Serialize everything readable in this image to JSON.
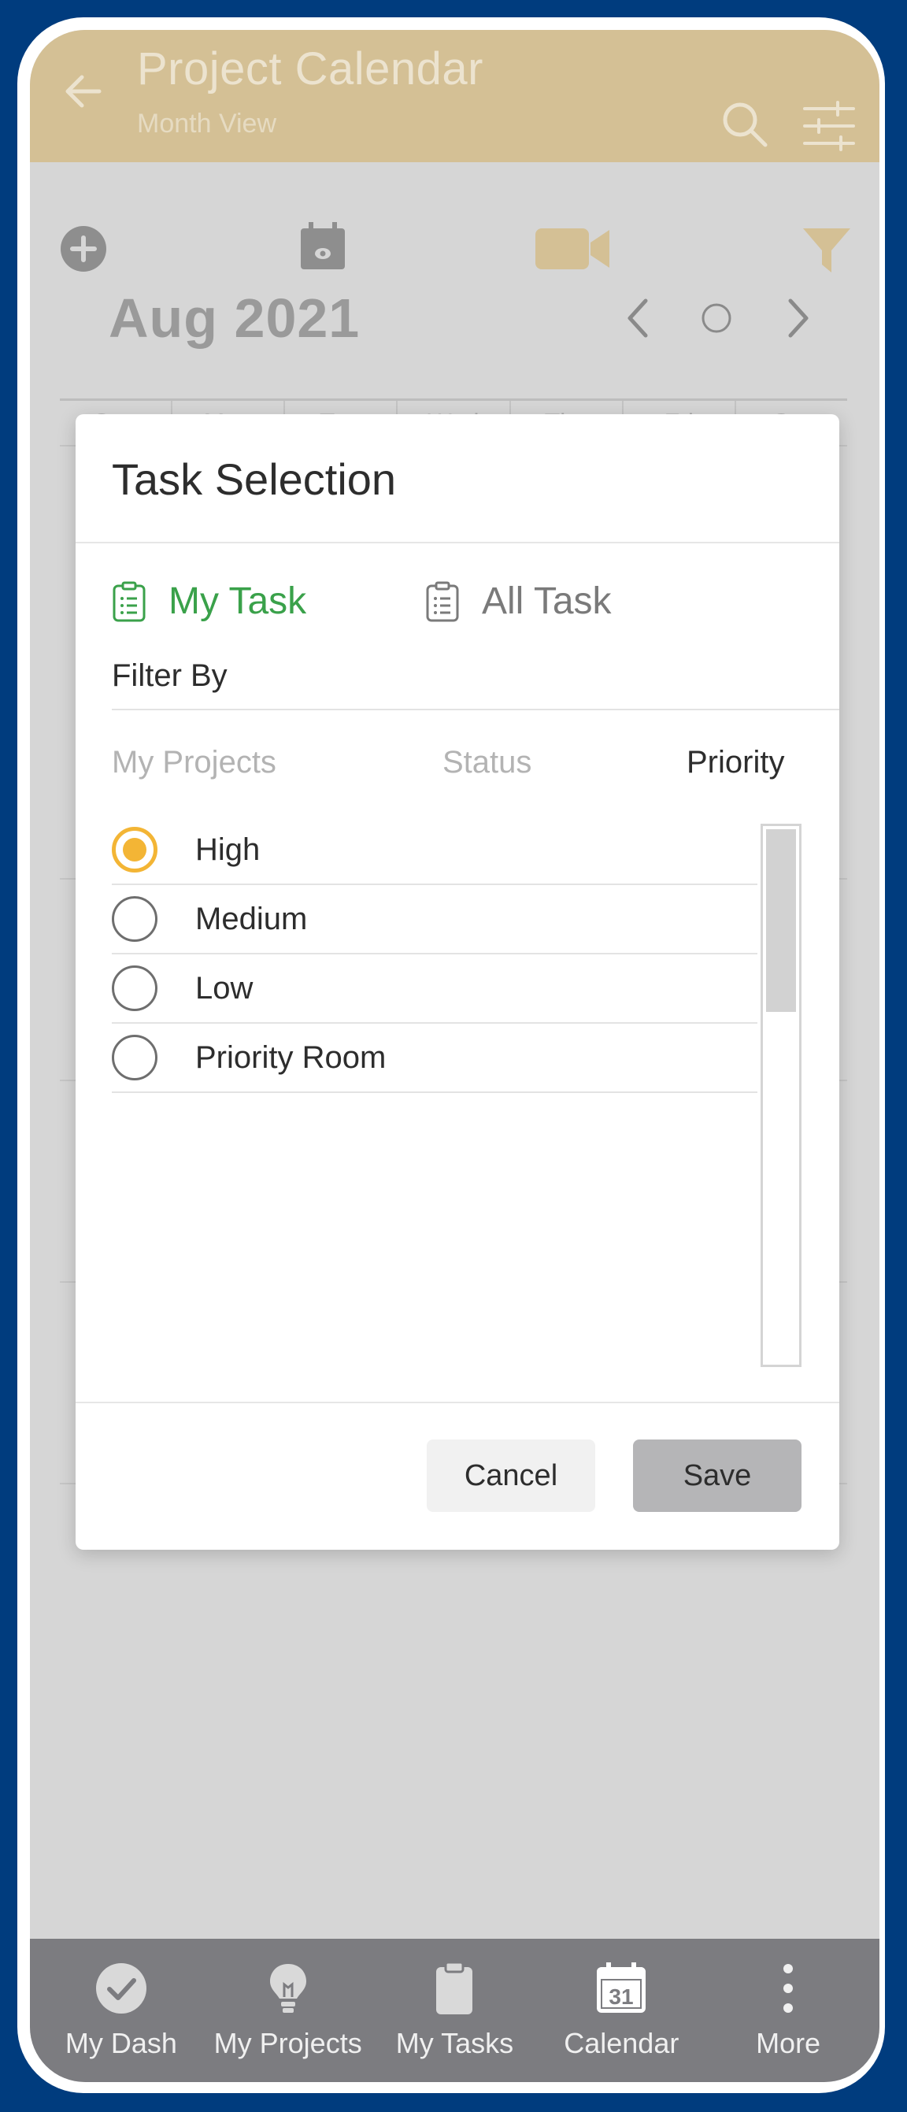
{
  "header": {
    "title": "Project Calendar",
    "subtitle": "Month View"
  },
  "calendar": {
    "month_label": "Aug 2021",
    "weekdays": [
      "Sun",
      "Mon",
      "Tue",
      "Wed",
      "Thu",
      "Fri",
      "Sat"
    ]
  },
  "dialog": {
    "title": "Task Selection",
    "task_tabs": [
      {
        "label": "My Task",
        "active": true
      },
      {
        "label": "All Task",
        "active": false
      }
    ],
    "filter_label": "Filter By",
    "filter_tabs": [
      {
        "label": "My Projects",
        "active": false
      },
      {
        "label": "Status",
        "active": false
      },
      {
        "label": "Priority",
        "active": true
      }
    ],
    "options": [
      {
        "label": "High",
        "selected": true
      },
      {
        "label": "Medium",
        "selected": false
      },
      {
        "label": "Low",
        "selected": false
      },
      {
        "label": "Priority Room",
        "selected": false
      }
    ],
    "cancel_label": "Cancel",
    "save_label": "Save"
  },
  "tabbar": {
    "items": [
      {
        "label": "My Dash",
        "icon": "check-circle-icon"
      },
      {
        "label": "My Projects",
        "icon": "lightbulb-icon"
      },
      {
        "label": "My Tasks",
        "icon": "clipboard-icon"
      },
      {
        "label": "Calendar",
        "icon": "calendar-icon",
        "badge": "31"
      },
      {
        "label": "More",
        "icon": "more-vertical-icon"
      }
    ]
  },
  "colors": {
    "header": "#d4c095",
    "accent_green": "#3aa14a",
    "radio_selected": "#f3b535",
    "frame": "#003c7e",
    "tabbar": "#7c7c80"
  }
}
